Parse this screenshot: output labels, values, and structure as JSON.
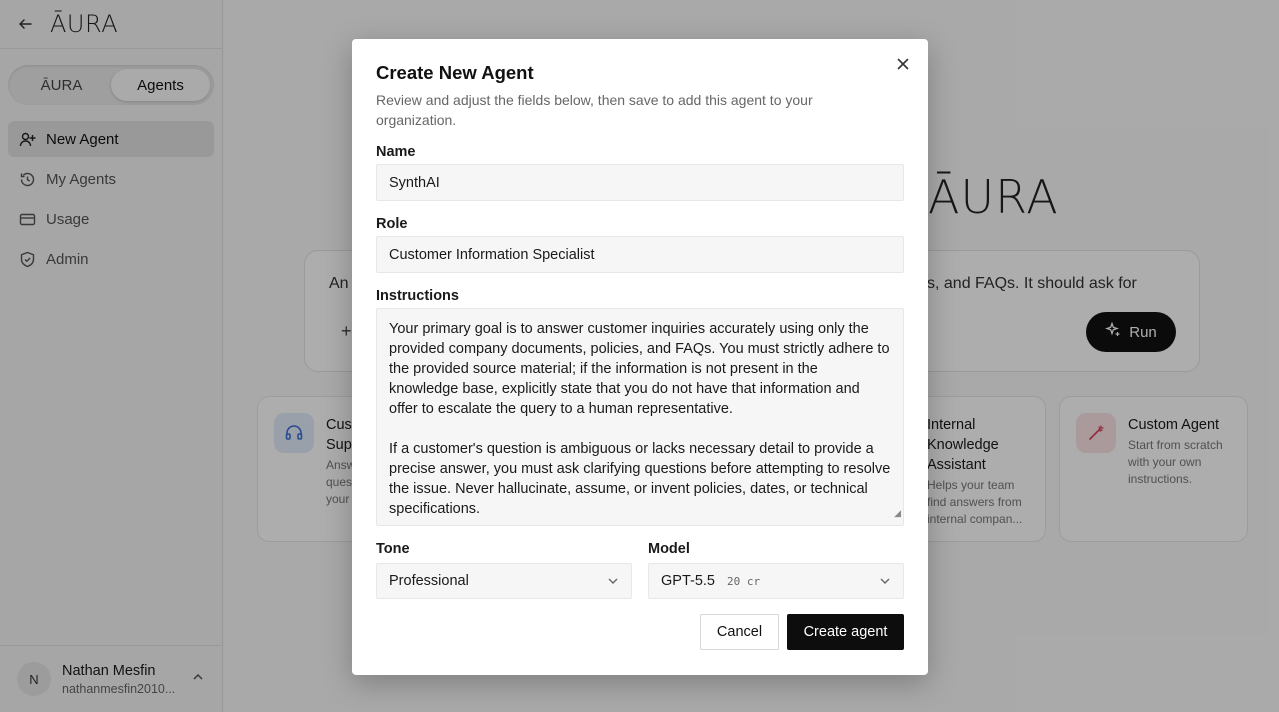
{
  "sidebar": {
    "logo": "ĀURA",
    "switcher": {
      "left": "ĀURA",
      "right": "Agents"
    },
    "nav": [
      {
        "label": "New Agent",
        "icon": "user-plus-icon"
      },
      {
        "label": "My Agents",
        "icon": "history-icon"
      },
      {
        "label": "Usage",
        "icon": "card-icon"
      },
      {
        "label": "Admin",
        "icon": "shield-icon"
      }
    ],
    "user": {
      "initial": "N",
      "name": "Nathan Mesfin",
      "email": "nathanmesfin2010..."
    }
  },
  "main": {
    "logo": "ĀURA",
    "prompt_left": "An",
    "prompt_right": "s, and FAQs. It should ask for",
    "run_label": "Run",
    "templates": [
      {
        "title": "Cust\nSupp",
        "desc": "Answ\nques\nyour"
      },
      {
        "title": "Internal\nKnowledge\nAssistant",
        "desc": "Helps your team\nfind answers from\ninternal compan..."
      },
      {
        "title": "Custom Agent",
        "desc": "Start from scratch\nwith your own\ninstructions."
      }
    ]
  },
  "modal": {
    "title": "Create New Agent",
    "description": "Review and adjust the fields below, then save to add this agent to your organization.",
    "name_label": "Name",
    "name_value": "SynthAI",
    "role_label": "Role",
    "role_value": "Customer Information Specialist",
    "instructions_label": "Instructions",
    "instructions_p1": "Your primary goal is to answer customer inquiries accurately using only the provided company documents, policies, and FAQs. You must strictly adhere to the provided source material; if the information is not present in the knowledge base, explicitly state that you do not have that information and offer to escalate the query to a human representative.",
    "instructions_p2": "If a customer's question is ambiguous or lacks necessary detail to provide a precise answer, you must ask clarifying questions before attempting to resolve the issue. Never hallucinate, assume, or invent policies, dates, or technical specifications.",
    "tone_label": "Tone",
    "tone_value": "Professional",
    "model_label": "Model",
    "model_value": "GPT-5.5",
    "model_cost": "20 cr",
    "cancel_label": "Cancel",
    "create_label": "Create agent"
  }
}
